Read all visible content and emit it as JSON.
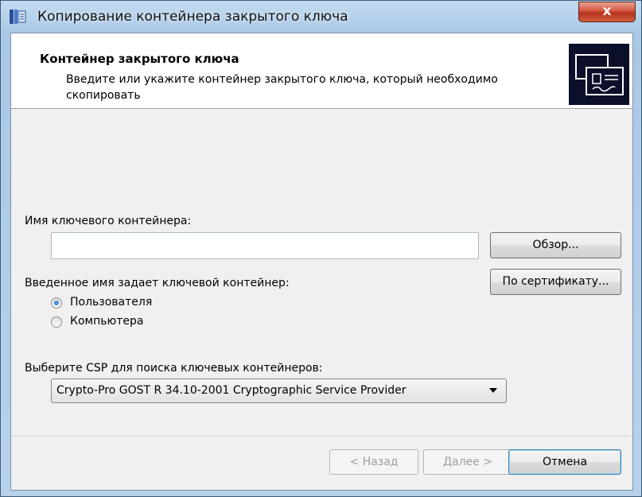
{
  "window": {
    "title": "Копирование контейнера закрытого ключа",
    "close_label": "x"
  },
  "header": {
    "title": "Контейнер закрытого ключа",
    "subtitle": "Введите или укажите контейнер закрытого ключа, который необходимо скопировать",
    "logo_icon": "certificate-icon"
  },
  "form": {
    "container_name_label": "Имя ключевого контейнера:",
    "container_name_value": "",
    "browse_button": "Обзор...",
    "by_certificate_button": "По сертификату...",
    "scope_label": "Введенное имя задает ключевой контейнер:",
    "scope_options": [
      {
        "label": "Пользователя",
        "checked": true
      },
      {
        "label": "Компьютера",
        "checked": false
      }
    ],
    "csp_label": "Выберите CSP для поиска ключевых контейнеров:",
    "csp_selected": "Crypto-Pro GOST R 34.10-2001 Cryptographic Service Provider"
  },
  "footer": {
    "back_button": "< Назад",
    "next_button": "Далее >",
    "cancel_button": "Отмена"
  },
  "colors": {
    "accent": "#3c7fb1",
    "close": "#c8412a",
    "logo_bg": "#0b0f2a"
  }
}
